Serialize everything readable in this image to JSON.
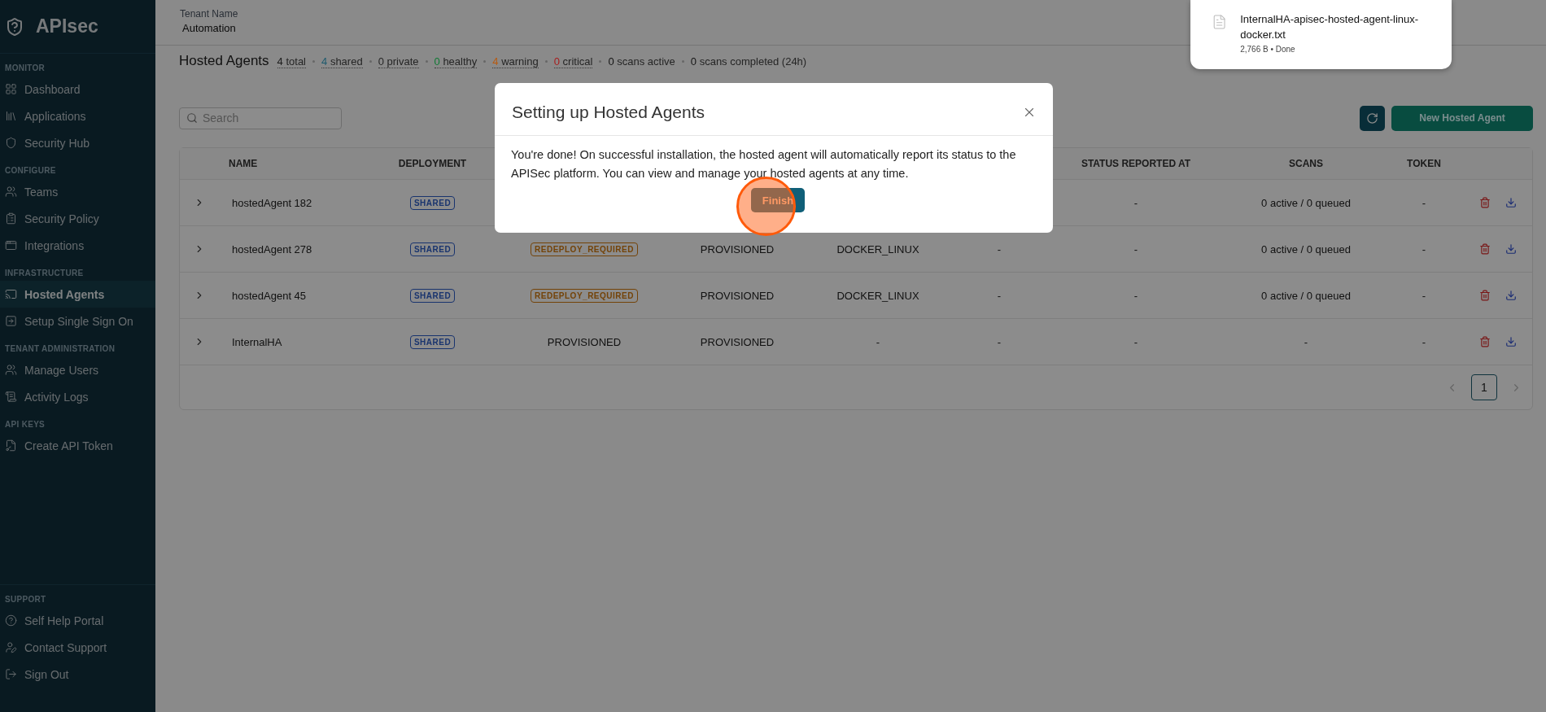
{
  "sidebar": {
    "logo": "APIsec",
    "sections": [
      {
        "heading": "MONITOR",
        "items": [
          {
            "label": "Dashboard",
            "selected": false
          },
          {
            "label": "Applications",
            "selected": false
          },
          {
            "label": "Security Hub",
            "selected": false
          }
        ]
      },
      {
        "heading": "CONFIGURE",
        "items": [
          {
            "label": "Teams",
            "selected": false
          },
          {
            "label": "Security Policy",
            "selected": false
          },
          {
            "label": "Integrations",
            "selected": false
          }
        ]
      },
      {
        "heading": "INFRASTRUCTURE",
        "items": [
          {
            "label": "Hosted Agents",
            "selected": true
          },
          {
            "label": "Setup Single Sign On",
            "selected": false
          }
        ]
      },
      {
        "heading": "TENANT ADMINISTRATION",
        "items": [
          {
            "label": "Manage Users",
            "selected": false
          },
          {
            "label": "Activity Logs",
            "selected": false
          }
        ]
      },
      {
        "heading": "API KEYS",
        "items": [
          {
            "label": "Create API Token",
            "selected": false
          }
        ]
      }
    ],
    "support": {
      "heading": "SUPPORT",
      "items": [
        {
          "label": "Self Help Portal",
          "selected": false
        },
        {
          "label": "Contact Support",
          "selected": false
        },
        {
          "label": "Sign Out",
          "selected": false
        }
      ]
    }
  },
  "topbar": {
    "label": "Tenant Name",
    "value": "Automation"
  },
  "page": {
    "title": "Hosted Agents",
    "stats": [
      {
        "count": "4",
        "label": "total",
        "color": "#1c1c1c",
        "underlined": true
      },
      {
        "count": "4",
        "label": "shared",
        "color": "#1e5a6e",
        "underlined": true
      },
      {
        "count": "0",
        "label": "private",
        "color": "#262626",
        "underlined": true
      },
      {
        "count": "0",
        "label": "healthy",
        "color": "#0f7a34",
        "underlined": true
      },
      {
        "count": "4",
        "label": "warning",
        "color": "#b85a10",
        "underlined": true
      },
      {
        "count": "0",
        "label": "critical",
        "color": "#a81c1c",
        "underlined": true
      },
      {
        "count": "0",
        "label": "scans active",
        "color": "#141414",
        "underlined": false
      },
      {
        "count": "0",
        "label": "scans completed (24h)",
        "color": "#141414",
        "underlined": false
      }
    ]
  },
  "search": {
    "placeholder": "Search"
  },
  "new_button": "New Hosted Agent",
  "table": {
    "columns": [
      "NAME",
      "DEPLOYMENT",
      "STATUS REPORTED AT",
      "SCANS",
      "TOKEN"
    ],
    "rows": [
      {
        "name": "hostedAgent 182",
        "deployment": "SHARED",
        "status_reported_at": "-",
        "scans": "0 active / 0 queued",
        "token": "-"
      },
      {
        "name": "hostedAgent 278",
        "deployment": "SHARED",
        "status": {
          "label": "REDEPLOY_REQUIRED",
          "kind": "badge"
        },
        "provisioning": "PROVISIONED",
        "platform": "DOCKER_LINUX",
        "column_6": "-",
        "status_reported_at": "-",
        "scans": "0 active / 0 queued",
        "token": "-"
      },
      {
        "name": "hostedAgent 45",
        "deployment": "SHARED",
        "status": {
          "label": "REDEPLOY_REQUIRED",
          "kind": "badge"
        },
        "provisioning": "PROVISIONED",
        "platform": "DOCKER_LINUX",
        "column_6": "-",
        "status_reported_at": "-",
        "scans": "0 active / 0 queued",
        "token": "-"
      },
      {
        "name": "InternalHA",
        "deployment": "SHARED",
        "status": {
          "label": "PROVISIONED",
          "kind": "text"
        },
        "provisioning": "PROVISIONED",
        "platform": "-",
        "column_6": "-",
        "status_reported_at": "-",
        "scans": "-",
        "token": "-"
      }
    ],
    "pages": [
      {
        "label": "1",
        "selected": true
      }
    ]
  },
  "modal": {
    "title": "Setting up Hosted Agents",
    "body": "You're done! On successful installation, the hosted agent will automatically report its status to the APISec platform. You can view and manage your hosted agents at any time.",
    "button": "Finish"
  },
  "download": {
    "filename": "InternalHA-apisec-hosted-agent-linux-docker.txt",
    "details": "2,766 B • Done"
  }
}
